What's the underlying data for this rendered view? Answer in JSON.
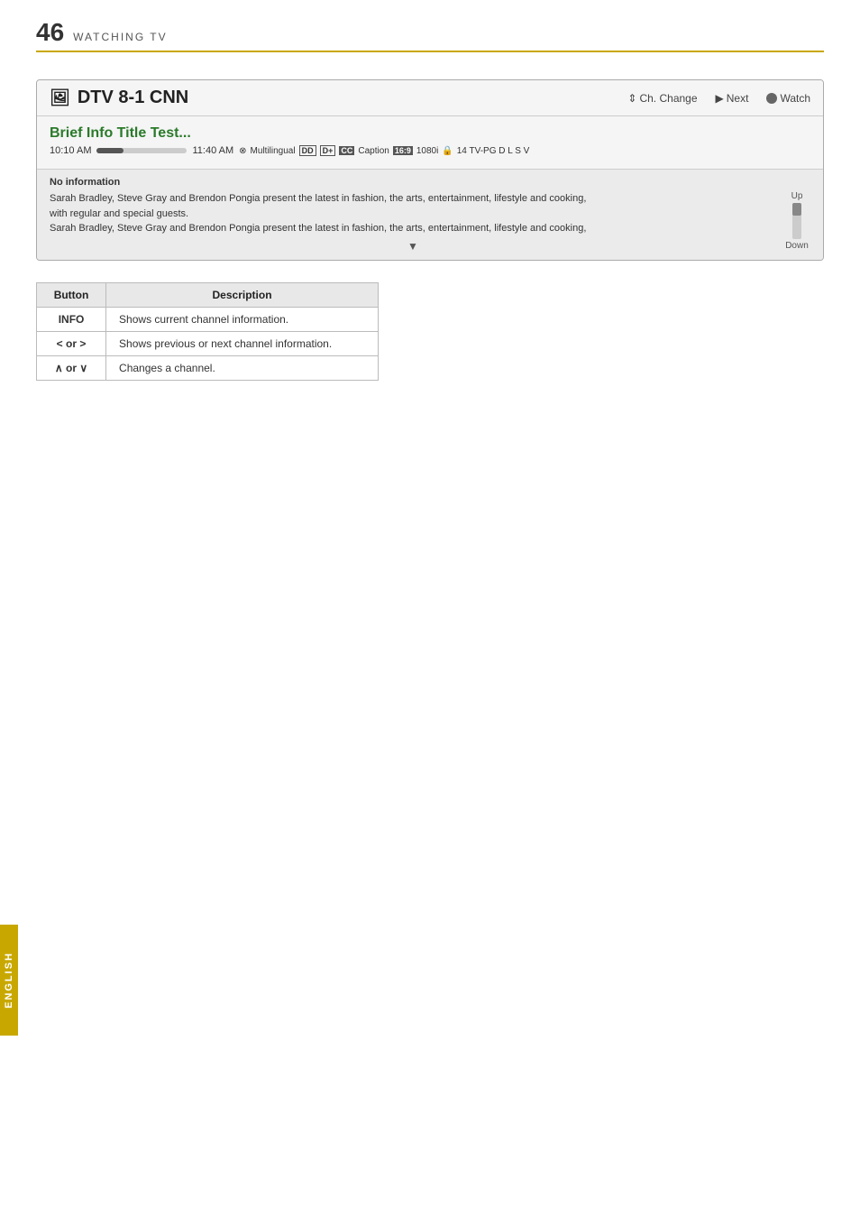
{
  "page": {
    "number": "46",
    "title": "WATCHING TV"
  },
  "infoBox": {
    "channelIcon": "🖥",
    "channelName": "DTV 8-1 CNN",
    "controls": {
      "chChange": "Ch. Change",
      "next": "Next",
      "watch": "Watch"
    },
    "program": {
      "title": "Brief Info Title Test...",
      "timeStart": "10:10 AM",
      "timeEnd": "11:40 AM",
      "metadata": "Multilingual DD+ CC Caption 16:9 1080i 🔒 14 TV-PG D L S V"
    },
    "noInfo": "No information",
    "descriptions": [
      "Sarah Bradley, Steve Gray and Brendon Pongia present the latest in fashion, the arts, entertainment, lifestyle and cooking,",
      "with regular and special guests.",
      "Sarah Bradley, Steve Gray and Brendon Pongia present the latest in fashion, the arts, entertainment, lifestyle and cooking,"
    ],
    "scrollLabels": {
      "up": "Up",
      "down": "Down"
    }
  },
  "table": {
    "headers": [
      "Button",
      "Description"
    ],
    "rows": [
      {
        "button": "INFO",
        "description": "Shows current channel information."
      },
      {
        "button": "< or >",
        "description": "Shows previous or next channel information."
      },
      {
        "button": "∧ or ∨",
        "description": "Changes a channel."
      }
    ]
  },
  "sidebar": {
    "label": "ENGLISH"
  }
}
